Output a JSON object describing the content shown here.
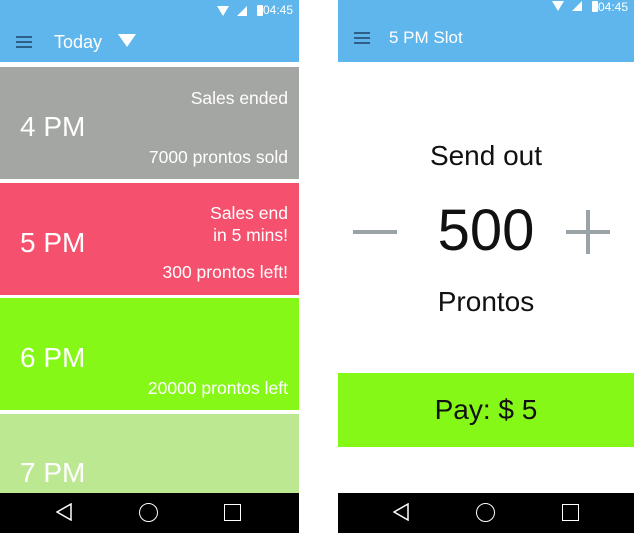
{
  "status_bar": {
    "time": "04:45"
  },
  "left_screen": {
    "app_bar": {
      "title": "Today"
    },
    "slots": [
      {
        "time": "4 PM",
        "status_lines": [
          "Sales ended"
        ],
        "detail": "7000 prontos sold",
        "color": "#a4a6a3"
      },
      {
        "time": "5 PM",
        "status_lines": [
          "Sales end",
          "in 5 mins!"
        ],
        "detail": "300 prontos left!",
        "color": "#f5516e"
      },
      {
        "time": "6 PM",
        "status_lines": [],
        "detail": "20000 prontos left",
        "color": "#86f817"
      },
      {
        "time": "7 PM",
        "status_lines": [],
        "detail": "",
        "color": "#bde892"
      }
    ]
  },
  "right_screen": {
    "app_bar": {
      "title": "5 PM Slot"
    },
    "send_label": "Send out",
    "quantity": "500",
    "unit_label": "Prontos",
    "pay_button": "Pay: $ 5"
  },
  "colors": {
    "app_bar": "#5fb6ec",
    "nav_bar": "#000000",
    "pay_button": "#86f817",
    "stepper": "#9aa3a5"
  },
  "icons": {
    "menu": "hamburger-menu-icon",
    "dropdown": "dropdown-arrow-icon",
    "minus": "minus-icon",
    "plus": "plus-icon",
    "back": "back-triangle-icon",
    "home": "home-circle-icon",
    "recent": "recent-apps-square-icon"
  }
}
